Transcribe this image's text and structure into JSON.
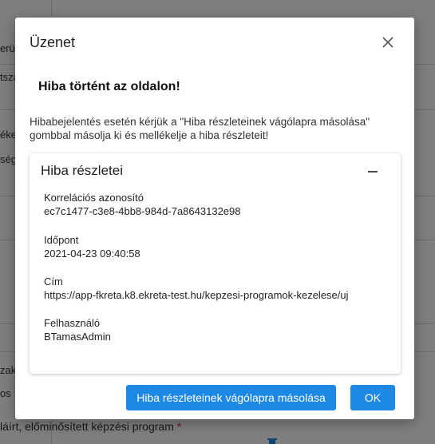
{
  "background": {
    "fragments": [
      "erü",
      "tsza",
      "éke",
      "ség",
      "zak",
      "os"
    ],
    "bottom_label": "láírt, előminősített képzési program",
    "required_mark": "*"
  },
  "dialog": {
    "title": "Üzenet",
    "heading": "Hiba történt az oldalon!",
    "description": "Hibabejelentés esetén kérjük a \"Hiba részleteinek vágólapra másolása\" gombbal másolja ki és mellékelje a hiba részleteit!",
    "details": {
      "title": "Hiba részletei",
      "fields": [
        {
          "label": "Korrelációs azonosító",
          "value": "ec7c1477-c3e8-4bb8-984d-7a8643132e98"
        },
        {
          "label": "Időpont",
          "value": "2021-04-23 09:40:58"
        },
        {
          "label": "Cím",
          "value": "https://app-fkreta.k8.ekreta-test.hu/kepzesi-programok-kezelese/uj"
        },
        {
          "label": "Felhasználó",
          "value": "BTamasAdmin"
        }
      ]
    },
    "buttons": {
      "copy": "Hiba részleteinek vágólapra másolása",
      "ok": "OK"
    }
  },
  "colors": {
    "primary": "#1e88e5",
    "overlay": "rgba(0,0,0,0.5)"
  },
  "icons": {
    "close": "close-icon",
    "collapse": "minus-icon",
    "trash": "trash-icon"
  }
}
